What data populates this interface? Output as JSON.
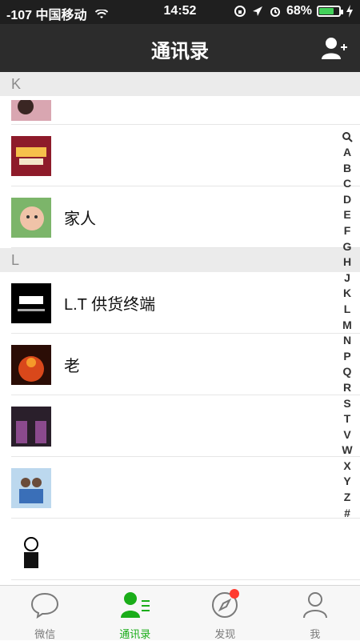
{
  "status": {
    "carrier": "-107 中国移动",
    "time": "14:52",
    "battery": "68%",
    "battery_level": 0.68
  },
  "header": {
    "title": "通讯录"
  },
  "contacts": {
    "sections": [
      {
        "letter": "K"
      },
      {
        "letter": "L"
      }
    ],
    "rows": [
      {
        "name": "",
        "avatar": "k-partial"
      },
      {
        "name": "",
        "avatar": "defend-land"
      },
      {
        "name": "家人",
        "avatar": "baby"
      },
      {
        "name": "L.T  供货终端",
        "avatar": "lt-sneaker"
      },
      {
        "name": "老",
        "avatar": "fire"
      },
      {
        "name": "",
        "avatar": "group-l"
      },
      {
        "name": "",
        "avatar": "friends"
      },
      {
        "name": "",
        "avatar": "sketch"
      }
    ]
  },
  "index": [
    "A",
    "B",
    "C",
    "D",
    "E",
    "F",
    "G",
    "H",
    "J",
    "K",
    "L",
    "M",
    "N",
    "P",
    "Q",
    "R",
    "S",
    "T",
    "V",
    "W",
    "X",
    "Y",
    "Z",
    "#"
  ],
  "tabs": [
    {
      "label": "微信"
    },
    {
      "label": "通讯录"
    },
    {
      "label": "发现"
    },
    {
      "label": "我"
    }
  ],
  "colors": {
    "accent": "#1aad19",
    "navbar": "#2c2c2c",
    "badge": "#ff3b30"
  }
}
